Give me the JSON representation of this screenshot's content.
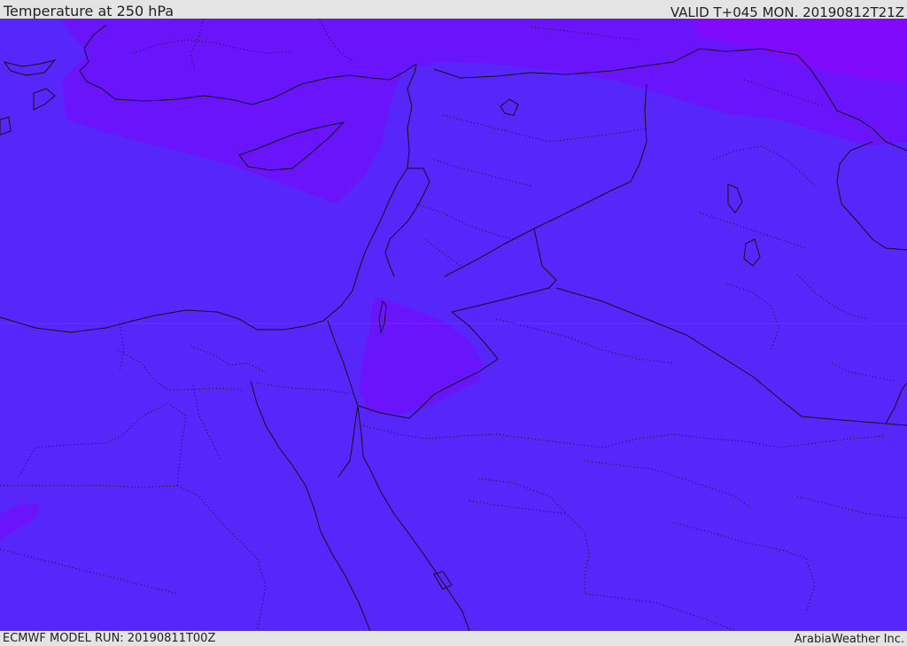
{
  "header": {
    "title": "Temperature at 250 hPa",
    "valid_time": "VALID T+045 MON. 20190812T21Z"
  },
  "footer": {
    "model_run": "ECMWF MODEL RUN: 20190811T00Z",
    "credit": "ArabiaWeather Inc."
  },
  "map": {
    "variable": "temperature",
    "pressure_level_hpa": 250,
    "colors": {
      "base_field": "#5726fb",
      "cooler_band": "#6a14fb",
      "coldest_band": "#7f0afc",
      "coastline": "#111111",
      "border": "#111111"
    }
  }
}
